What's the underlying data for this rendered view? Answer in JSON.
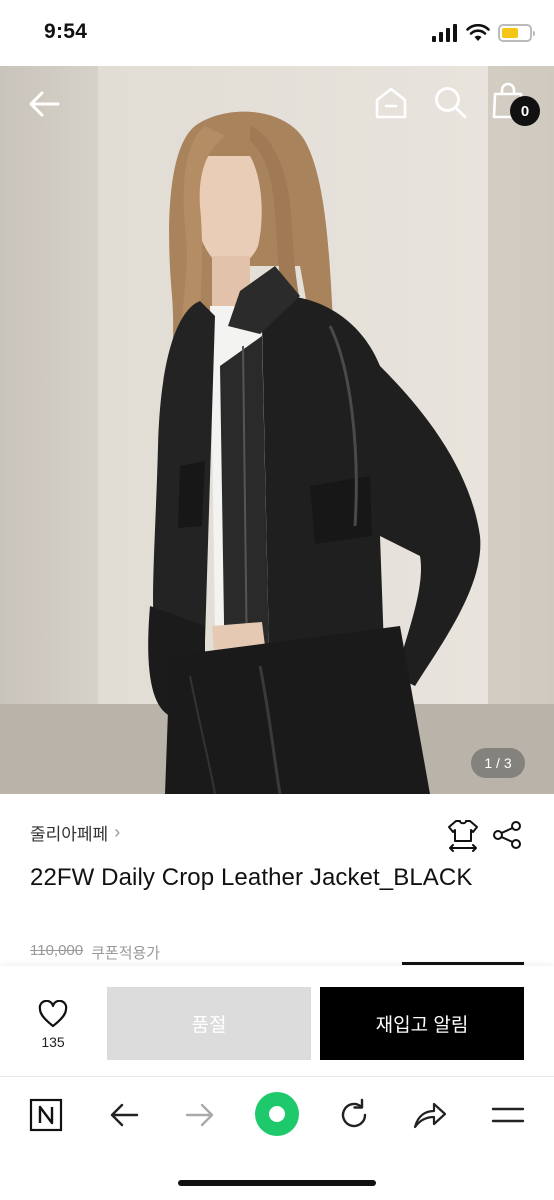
{
  "status": {
    "time": "9:54"
  },
  "hero": {
    "image_counter": "1 / 3",
    "cart_count": "0"
  },
  "product": {
    "brand": "줄리아페페",
    "title": "22FW Daily Crop Leather Jacket_BLACK",
    "price_original": "110,000",
    "coupon_label": "쿠폰적용가"
  },
  "purchase": {
    "like_count": "135",
    "soldout_label": "품절",
    "restock_label": "재입고 알림"
  },
  "colors": {
    "accent": "#000000",
    "disabled": "#dcdcdc",
    "refresh_green": "#1ec96b",
    "battery": "#f5c518"
  },
  "icons": [
    "back-icon",
    "home-icon",
    "search-icon",
    "shopping-bag-icon",
    "size-guide-icon",
    "share-icon",
    "heart-icon",
    "naver-icon",
    "browser-back-icon",
    "browser-forward-icon",
    "green-dot-icon",
    "refresh-icon",
    "browser-share-icon",
    "menu-icon"
  ]
}
